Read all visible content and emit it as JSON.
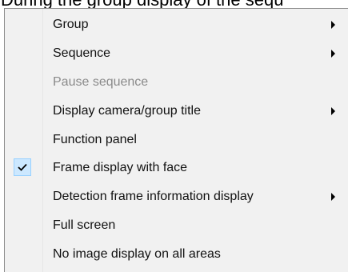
{
  "document": {
    "text": "During the group display of the sequ"
  },
  "menu": {
    "items": [
      {
        "label": "Group",
        "has_submenu": true,
        "disabled": false,
        "checked": false
      },
      {
        "label": "Sequence",
        "has_submenu": true,
        "disabled": false,
        "checked": false
      },
      {
        "label": "Pause sequence",
        "has_submenu": false,
        "disabled": true,
        "checked": false
      },
      {
        "label": "Display camera/group title",
        "has_submenu": true,
        "disabled": false,
        "checked": false
      },
      {
        "label": "Function panel",
        "has_submenu": false,
        "disabled": false,
        "checked": false
      },
      {
        "label": "Frame display with face",
        "has_submenu": false,
        "disabled": false,
        "checked": true
      },
      {
        "label": "Detection frame information display",
        "has_submenu": true,
        "disabled": false,
        "checked": false
      },
      {
        "label": "Full screen",
        "has_submenu": false,
        "disabled": false,
        "checked": false
      },
      {
        "label": "No image display on all areas",
        "has_submenu": false,
        "disabled": false,
        "checked": false
      }
    ],
    "icons": {
      "submenu": "chevron-right-icon",
      "check": "checkmark-icon"
    },
    "colors": {
      "background": "#f1f1f1",
      "disabled_text": "#8a8a8a",
      "check_highlight": "#cce8ff",
      "check_border": "#99d1ff"
    }
  }
}
